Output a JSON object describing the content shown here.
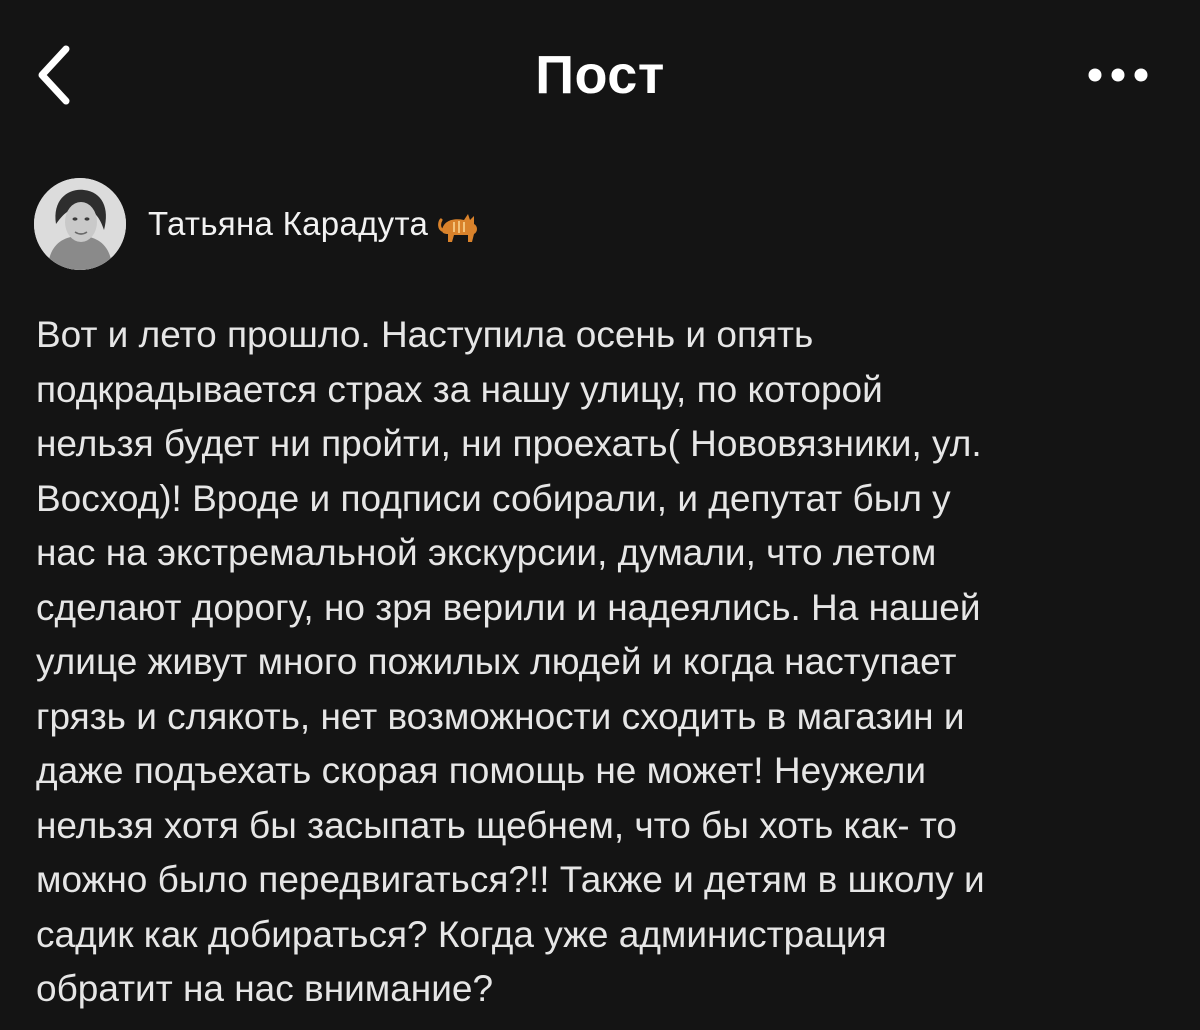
{
  "header": {
    "title": "Пост",
    "back_icon": "chevron-left-icon",
    "more_icon": "more-horizontal-icon"
  },
  "author": {
    "name": "Татьяна Карадута",
    "status_emoji": "cat-icon"
  },
  "post": {
    "lines": [
      "Вот и лето прошло. Наступила осень и опять",
      "подкрадывается страх за нашу улицу, по которой",
      "нельзя будет ни пройти, ни проехать( Нововязники, ул.",
      "Восход)! Вроде и подписи собирали, и депутат был у",
      "нас на экстремальной экскурсии, думали, что летом",
      "сделают дорогу, но зря верили и надеялись. На нашей",
      "улице живут много пожилых людей и когда наступает",
      "грязь и слякоть, нет возможности сходить в магазин и",
      "даже подъехать скорая помощь не может! Неужели",
      "нельзя хотя бы засыпать щебнем, что бы хоть как- то",
      "можно было передвигаться?!! Также и детям в школу и",
      "садик как добираться? Когда уже администрация",
      "обратит на нас внимание?"
    ]
  },
  "colors": {
    "background": "#141414",
    "text": "#e6e6e6",
    "title": "#ffffff"
  }
}
